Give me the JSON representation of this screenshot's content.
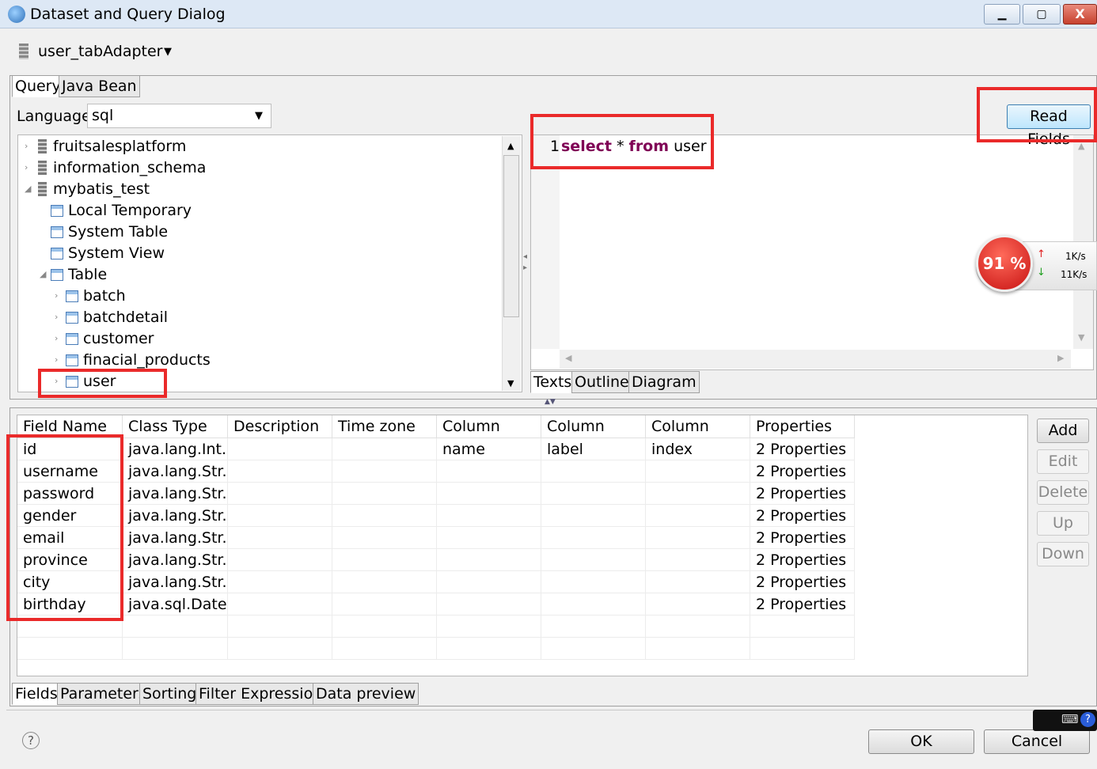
{
  "window": {
    "title": "Dataset and Query Dialog",
    "close_glyph": "X"
  },
  "adapter": {
    "label": "user_tabAdapter"
  },
  "query_tabs": [
    "Query",
    "Java Bean"
  ],
  "language": {
    "label": "Language",
    "value": "sql"
  },
  "tree": {
    "items": [
      {
        "label": "fruitsalesplatform",
        "level": 0,
        "icon": "database-icon",
        "twisty": "›"
      },
      {
        "label": "information_schema",
        "level": 0,
        "icon": "database-icon",
        "twisty": "›"
      },
      {
        "label": "mybatis_test",
        "level": 0,
        "icon": "database-icon",
        "twisty": "◢"
      },
      {
        "label": "Local Temporary",
        "level": 1,
        "icon": "table-icon",
        "twisty": ""
      },
      {
        "label": "System Table",
        "level": 1,
        "icon": "table-icon",
        "twisty": ""
      },
      {
        "label": "System View",
        "level": 1,
        "icon": "table-icon",
        "twisty": ""
      },
      {
        "label": "Table",
        "level": 1,
        "icon": "table-icon",
        "twisty": "◢"
      },
      {
        "label": "batch",
        "level": 2,
        "icon": "table-icon",
        "twisty": "›"
      },
      {
        "label": "batchdetail",
        "level": 2,
        "icon": "table-icon",
        "twisty": "›"
      },
      {
        "label": "customer",
        "level": 2,
        "icon": "table-icon",
        "twisty": "›"
      },
      {
        "label": "finacial_products",
        "level": 2,
        "icon": "table-icon",
        "twisty": "›"
      },
      {
        "label": "user",
        "level": 2,
        "icon": "table-icon",
        "twisty": "›"
      }
    ]
  },
  "editor": {
    "line_number": "1",
    "kw_select": "select",
    "star": " * ",
    "kw_from": "from",
    "table": " user",
    "tabs": [
      "Texts",
      "Outline",
      "Diagram"
    ]
  },
  "read_fields_label": "Read Fields",
  "speed": {
    "percent": "91 %",
    "up": "1K/s",
    "down": "11K/s"
  },
  "fields_table": {
    "columns": [
      "Field Name",
      "Class Type",
      "Description",
      "Time zone",
      "Column name",
      "Column label",
      "Column index",
      "Properties"
    ],
    "rows": [
      [
        "id",
        "java.lang.Int...",
        "",
        "",
        "",
        "",
        "",
        "2 Properties"
      ],
      [
        "username",
        "java.lang.Str...",
        "",
        "",
        "",
        "",
        "",
        "2 Properties"
      ],
      [
        "password",
        "java.lang.Str...",
        "",
        "",
        "",
        "",
        "",
        "2 Properties"
      ],
      [
        "gender",
        "java.lang.Str...",
        "",
        "",
        "",
        "",
        "",
        "2 Properties"
      ],
      [
        "email",
        "java.lang.Str...",
        "",
        "",
        "",
        "",
        "",
        "2 Properties"
      ],
      [
        "province",
        "java.lang.Str...",
        "",
        "",
        "",
        "",
        "",
        "2 Properties"
      ],
      [
        "city",
        "java.lang.Str...",
        "",
        "",
        "",
        "",
        "",
        "2 Properties"
      ],
      [
        "birthday",
        "java.sql.Date",
        "",
        "",
        "",
        "",
        "",
        "2 Properties"
      ]
    ]
  },
  "side_buttons": [
    {
      "label": "Add",
      "enabled": true
    },
    {
      "label": "Edit",
      "enabled": false
    },
    {
      "label": "Delete",
      "enabled": false
    },
    {
      "label": "Up",
      "enabled": false
    },
    {
      "label": "Down",
      "enabled": false
    }
  ],
  "bottom_tabs": [
    "Fields",
    "Parameters",
    "Sorting",
    "Filter Expression",
    "Data preview"
  ],
  "footer": {
    "help": "?",
    "ok": "OK",
    "cancel": "Cancel"
  },
  "colors": {
    "highlight": "#ea2a2a",
    "keyword": "#7f0055",
    "accent": "#3c7fb1"
  }
}
